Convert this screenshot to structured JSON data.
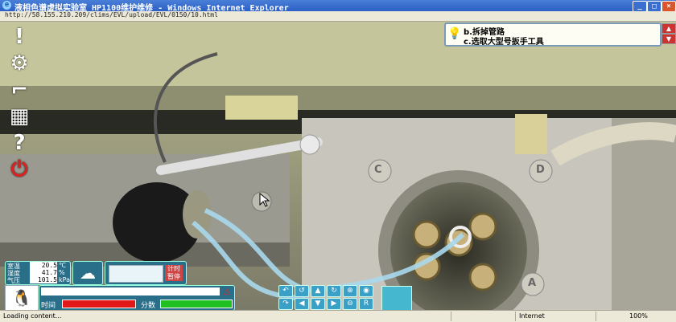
{
  "window": {
    "title": "液相色谱虚拟实验室 HP1100维护维修 - Windows Internet Explorer",
    "url": "http://58.155.210.209/clims/EVL/upload/EVL/0150/10.html"
  },
  "left_toolbar": {
    "items": [
      {
        "name": "exclamation-icon",
        "glyph": "!"
      },
      {
        "name": "gear-icon",
        "glyph": "⚙"
      },
      {
        "name": "chart-icon",
        "glyph": "⌐"
      },
      {
        "name": "grid-icon",
        "glyph": "▦"
      },
      {
        "name": "help-icon",
        "glyph": "?"
      },
      {
        "name": "power-icon",
        "glyph": "⏻"
      }
    ]
  },
  "instructions": {
    "line1": "b.拆掉管路",
    "line2": "c.选取大型号扳手工具"
  },
  "scene_labels": {
    "c": "C",
    "d": "D",
    "a": "A"
  },
  "environment": {
    "temperature": {
      "label": "室温",
      "value": "20.5",
      "unit": "℃"
    },
    "humidity": {
      "label": "湿度",
      "value": "41.7",
      "unit": "%"
    },
    "pressure": {
      "label": "气压",
      "value": "101.5",
      "unit": "kPa"
    }
  },
  "timer_button": "计时\n暂停",
  "status": {
    "time_label": "时间",
    "score_label": "分数"
  },
  "statusbar": {
    "loading": "Loading content...",
    "zone": "Internet",
    "zoom": "100%"
  },
  "colors": {
    "accent": "#2a6f8a",
    "time_bar": "#e01818",
    "score_bar": "#20c020"
  }
}
